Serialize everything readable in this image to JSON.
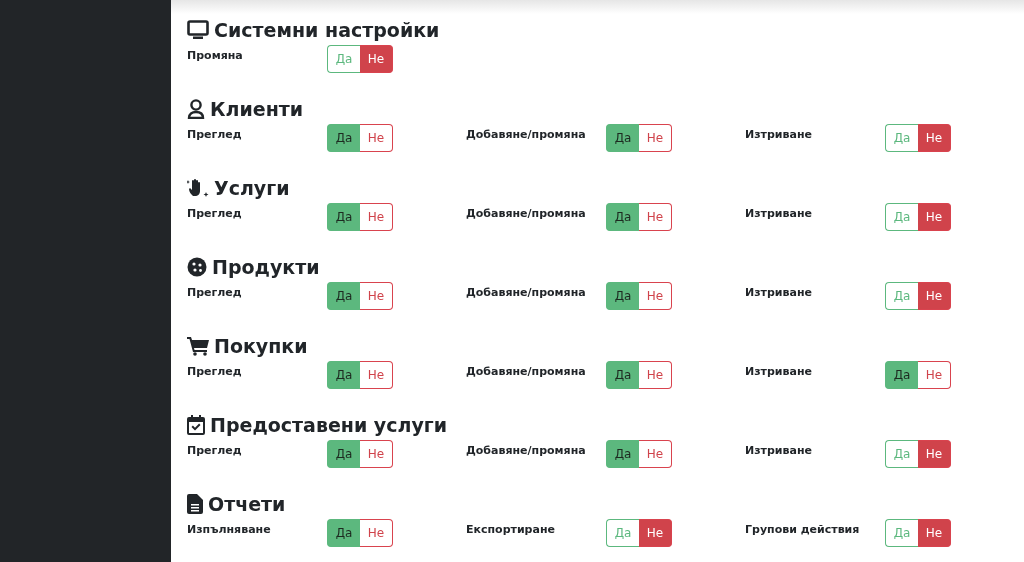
{
  "sections": [
    {
      "title": "Системни настройки",
      "permissions": [
        {
          "label": "Промяна",
          "options": [
            {
              "label": "Да",
              "selected": false
            },
            {
              "label": "Не",
              "selected": true
            }
          ]
        }
      ]
    },
    {
      "title": "Клиенти",
      "permissions": [
        {
          "label": "Преглед",
          "options": [
            {
              "label": "Да",
              "selected": true
            },
            {
              "label": "Не",
              "selected": false
            }
          ]
        },
        {
          "label": "Добавяне/промяна",
          "options": [
            {
              "label": "Да",
              "selected": true
            },
            {
              "label": "Не",
              "selected": false
            }
          ]
        },
        {
          "label": "Изтриване",
          "options": [
            {
              "label": "Да",
              "selected": false
            },
            {
              "label": "Не",
              "selected": true
            }
          ]
        }
      ]
    },
    {
      "title": "Услуги",
      "permissions": [
        {
          "label": "Преглед",
          "options": [
            {
              "label": "Да",
              "selected": true
            },
            {
              "label": "Не",
              "selected": false
            }
          ]
        },
        {
          "label": "Добавяне/промяна",
          "options": [
            {
              "label": "Да",
              "selected": true
            },
            {
              "label": "Не",
              "selected": false
            }
          ]
        },
        {
          "label": "Изтриване",
          "options": [
            {
              "label": "Да",
              "selected": false
            },
            {
              "label": "Не",
              "selected": true
            }
          ]
        }
      ]
    },
    {
      "title": "Продукти",
      "permissions": [
        {
          "label": "Преглед",
          "options": [
            {
              "label": "Да",
              "selected": true
            },
            {
              "label": "Не",
              "selected": false
            }
          ]
        },
        {
          "label": "Добавяне/промяна",
          "options": [
            {
              "label": "Да",
              "selected": true
            },
            {
              "label": "Не",
              "selected": false
            }
          ]
        },
        {
          "label": "Изтриване",
          "options": [
            {
              "label": "Да",
              "selected": false
            },
            {
              "label": "Не",
              "selected": true
            }
          ]
        }
      ]
    },
    {
      "title": "Покупки",
      "permissions": [
        {
          "label": "Преглед",
          "options": [
            {
              "label": "Да",
              "selected": true
            },
            {
              "label": "Не",
              "selected": false
            }
          ]
        },
        {
          "label": "Добавяне/промяна",
          "options": [
            {
              "label": "Да",
              "selected": true
            },
            {
              "label": "Не",
              "selected": false
            }
          ]
        },
        {
          "label": "Изтриване",
          "options": [
            {
              "label": "Да",
              "selected": true
            },
            {
              "label": "Не",
              "selected": false
            }
          ]
        }
      ]
    },
    {
      "title": "Предоставени услуги",
      "permissions": [
        {
          "label": "Преглед",
          "options": [
            {
              "label": "Да",
              "selected": true
            },
            {
              "label": "Не",
              "selected": false
            }
          ]
        },
        {
          "label": "Добавяне/промяна",
          "options": [
            {
              "label": "Да",
              "selected": true
            },
            {
              "label": "Не",
              "selected": false
            }
          ]
        },
        {
          "label": "Изтриване",
          "options": [
            {
              "label": "Да",
              "selected": false
            },
            {
              "label": "Не",
              "selected": true
            }
          ]
        }
      ]
    },
    {
      "title": "Отчети",
      "permissions": [
        {
          "label": "Изпълняване",
          "options": [
            {
              "label": "Да",
              "selected": true
            },
            {
              "label": "Не",
              "selected": false
            }
          ]
        },
        {
          "label": "Експортиране",
          "options": [
            {
              "label": "Да",
              "selected": false
            },
            {
              "label": "Не",
              "selected": true
            }
          ]
        },
        {
          "label": "Групови действия",
          "options": [
            {
              "label": "Да",
              "selected": false
            },
            {
              "label": "Не",
              "selected": true
            }
          ]
        }
      ]
    }
  ]
}
